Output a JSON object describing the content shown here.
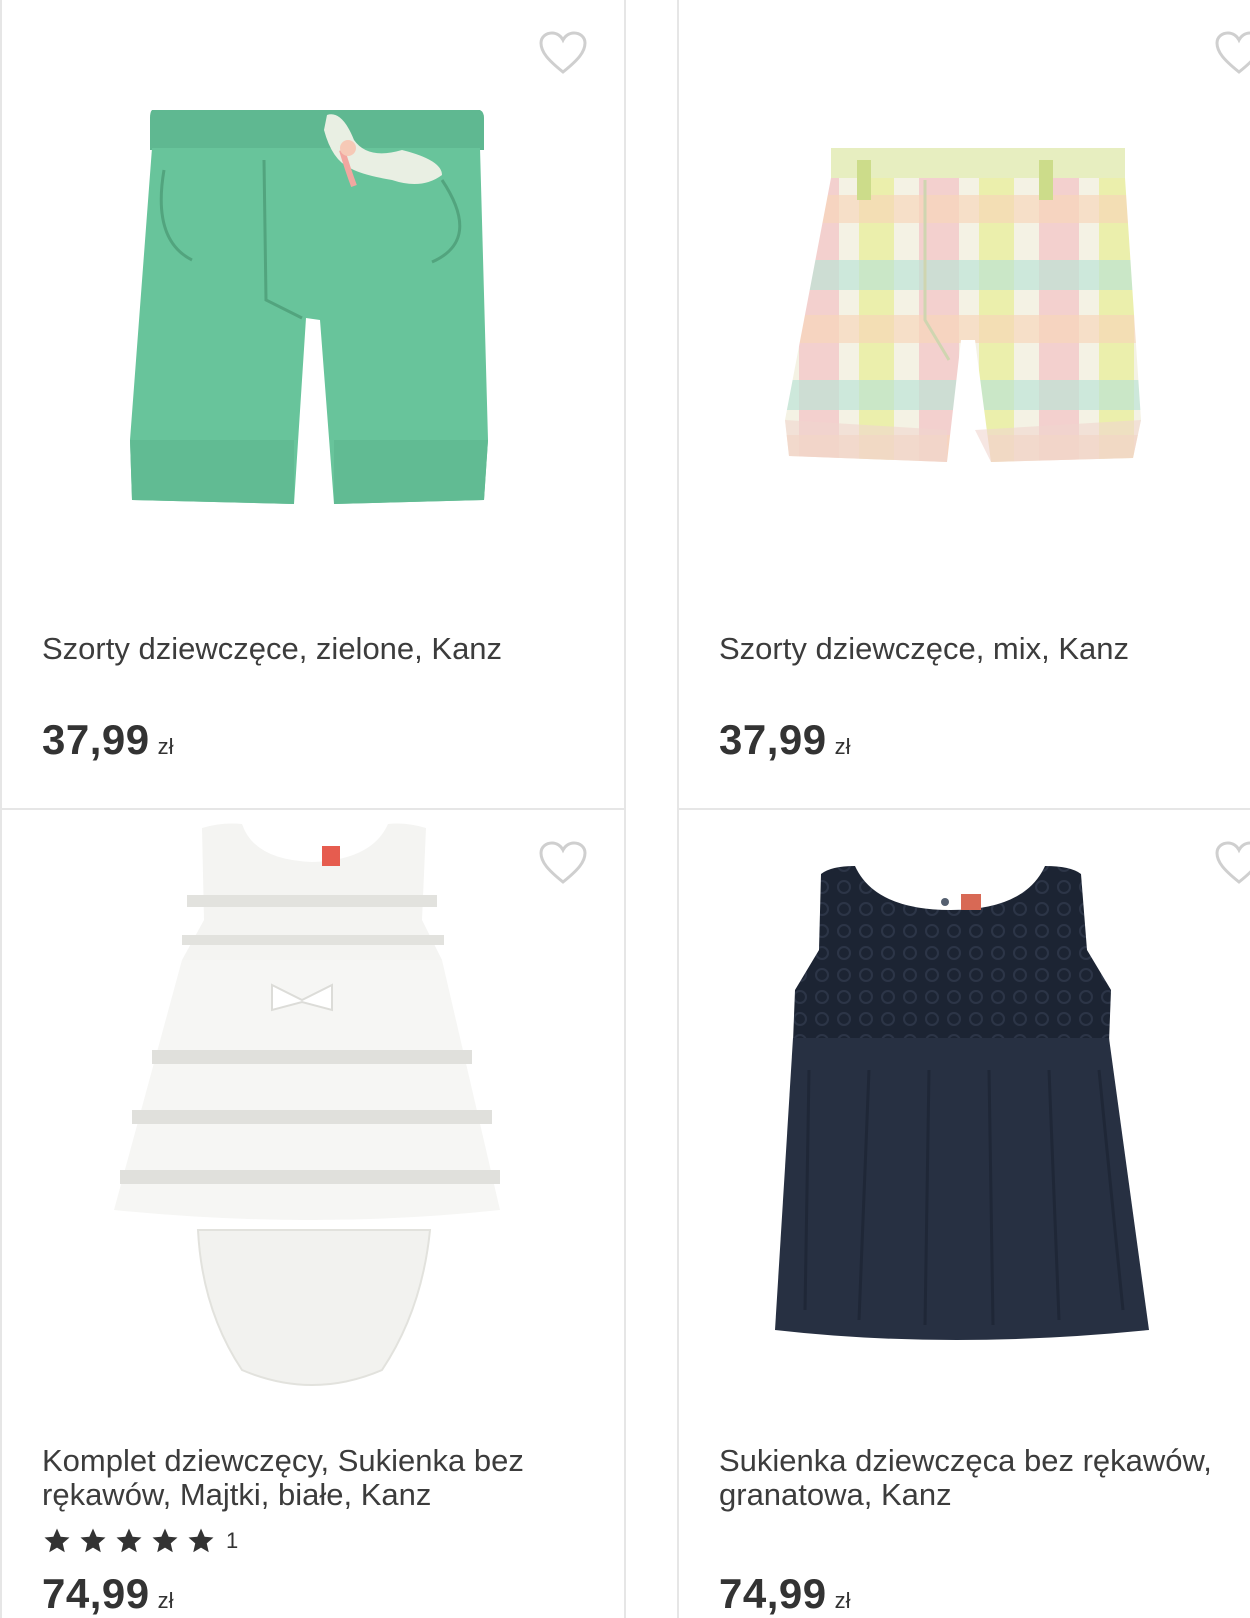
{
  "products": [
    {
      "title": "Szorty dziewczęce, zielone, Kanz",
      "price": "37,99",
      "currency": "zł",
      "image": "green-shorts",
      "favorite_icon": "heart-outline-icon"
    },
    {
      "title": "Szorty dziewczęce, mix, Kanz",
      "price": "37,99",
      "currency": "zł",
      "image": "plaid-shorts",
      "favorite_icon": "heart-outline-icon"
    },
    {
      "title": "Komplet dziewczęcy, Sukienka bez\nrękawów, Majtki, białe, Kanz",
      "price": "74,99",
      "currency": "zł",
      "rating": {
        "stars": 5,
        "count": "1"
      },
      "image": "white-dress-set",
      "favorite_icon": "heart-outline-icon"
    },
    {
      "title": "Sukienka dziewczęca bez rękawów,\ngranatowa, Kanz",
      "price": "74,99",
      "currency": "zł",
      "image": "navy-dress",
      "favorite_icon": "heart-outline-icon"
    }
  ],
  "colors": {
    "card_border": "#e6e6e6",
    "text": "#3c3c3c",
    "price": "#333333",
    "star": "#333333",
    "heart_outline": "#cfcfcf"
  }
}
